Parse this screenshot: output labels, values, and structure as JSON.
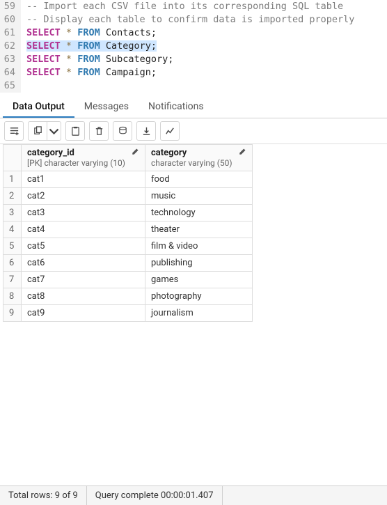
{
  "editor": {
    "lines": [
      {
        "num": 59,
        "segments": [
          {
            "cls": "comment",
            "text": "-- Import each CSV file into its corresponding SQL table"
          }
        ]
      },
      {
        "num": 60,
        "segments": [
          {
            "cls": "comment",
            "text": "-- Display each table to confirm data is imported properly"
          }
        ]
      },
      {
        "num": 61,
        "segments": [
          {
            "cls": "kw-select",
            "text": "SELECT"
          },
          {
            "cls": "",
            "text": " "
          },
          {
            "cls": "star",
            "text": "*"
          },
          {
            "cls": "",
            "text": " "
          },
          {
            "cls": "kw-from",
            "text": "FROM"
          },
          {
            "cls": "",
            "text": " "
          },
          {
            "cls": "ident",
            "text": "Contacts;"
          }
        ]
      },
      {
        "num": 62,
        "highlight": true,
        "segments": [
          {
            "cls": "kw-select",
            "text": "SELECT"
          },
          {
            "cls": "",
            "text": " "
          },
          {
            "cls": "star",
            "text": "*"
          },
          {
            "cls": "",
            "text": " "
          },
          {
            "cls": "kw-from",
            "text": "FROM"
          },
          {
            "cls": "",
            "text": " "
          },
          {
            "cls": "ident",
            "text": "Category;"
          }
        ]
      },
      {
        "num": 63,
        "segments": [
          {
            "cls": "kw-select",
            "text": "SELECT"
          },
          {
            "cls": "",
            "text": " "
          },
          {
            "cls": "star",
            "text": "*"
          },
          {
            "cls": "",
            "text": " "
          },
          {
            "cls": "kw-from",
            "text": "FROM"
          },
          {
            "cls": "",
            "text": " "
          },
          {
            "cls": "ident",
            "text": "Subcategory;"
          }
        ]
      },
      {
        "num": 64,
        "segments": [
          {
            "cls": "kw-select",
            "text": "SELECT"
          },
          {
            "cls": "",
            "text": " "
          },
          {
            "cls": "star",
            "text": "*"
          },
          {
            "cls": "",
            "text": " "
          },
          {
            "cls": "kw-from",
            "text": "FROM"
          },
          {
            "cls": "",
            "text": " "
          },
          {
            "cls": "ident",
            "text": "Campaign;"
          }
        ]
      },
      {
        "num": 65,
        "segments": []
      }
    ]
  },
  "tabs": {
    "data_output": "Data Output",
    "messages": "Messages",
    "notifications": "Notifications"
  },
  "columns": [
    {
      "name": "category_id",
      "type": "[PK] character varying (10)"
    },
    {
      "name": "category",
      "type": "character varying (50)"
    }
  ],
  "rows": [
    {
      "n": 1,
      "category_id": "cat1",
      "category": "food"
    },
    {
      "n": 2,
      "category_id": "cat2",
      "category": "music"
    },
    {
      "n": 3,
      "category_id": "cat3",
      "category": "technology"
    },
    {
      "n": 4,
      "category_id": "cat4",
      "category": "theater"
    },
    {
      "n": 5,
      "category_id": "cat5",
      "category": "film & video"
    },
    {
      "n": 6,
      "category_id": "cat6",
      "category": "publishing"
    },
    {
      "n": 7,
      "category_id": "cat7",
      "category": "games"
    },
    {
      "n": 8,
      "category_id": "cat8",
      "category": "photography"
    },
    {
      "n": 9,
      "category_id": "cat9",
      "category": "journalism"
    }
  ],
  "status": {
    "rows": "Total rows: 9 of 9",
    "time": "Query complete 00:00:01.407"
  }
}
